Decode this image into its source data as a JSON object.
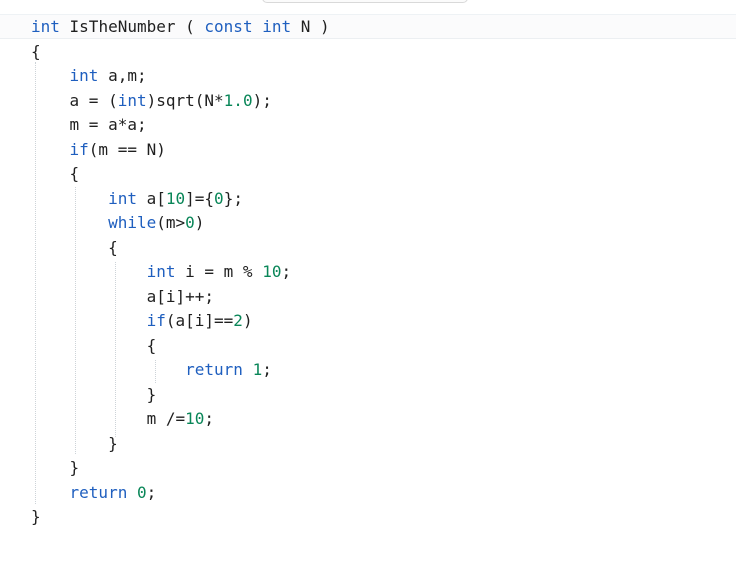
{
  "editor": {
    "code_lines": [
      "int IsTheNumber ( const int N )",
      "{",
      "    int a,m;",
      "    a = (int)sqrt(N*1.0);",
      "    m = a*a;",
      "    if(m == N)",
      "    {",
      "        int a[10]={0};",
      "        while(m>0)",
      "        {",
      "            int i = m % 10;",
      "            a[i]++;",
      "            if(a[i]==2)",
      "            {",
      "                return 1;",
      "            }",
      "            m /=10;",
      "        }",
      "    }",
      "    return 0;",
      "}"
    ],
    "keyword_color": "#1f5fbf",
    "number_color": "#098658",
    "text_color": "#1f1f1f"
  }
}
